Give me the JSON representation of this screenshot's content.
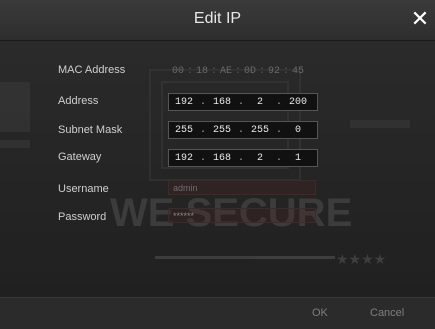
{
  "dialog": {
    "title": "Edit IP",
    "close_label": "✕"
  },
  "fields": {
    "mac_label": "MAC Address",
    "mac_octets": [
      "00",
      "18",
      "AE",
      "0D",
      "92",
      "45"
    ],
    "address_label": "Address",
    "address_octets": [
      "192",
      "168",
      "2",
      "200"
    ],
    "subnet_label": "Subnet Mask",
    "subnet_octets": [
      "255",
      "255",
      "255",
      "0"
    ],
    "gateway_label": "Gateway",
    "gateway_octets": [
      "192",
      "168",
      "2",
      "1"
    ],
    "username_label": "Username",
    "username_value": "admin",
    "password_label": "Password",
    "password_value": "******"
  },
  "watermark": {
    "text": "WE SECURE"
  },
  "footer": {
    "ok_label": "OK",
    "cancel_label": "Cancel"
  }
}
